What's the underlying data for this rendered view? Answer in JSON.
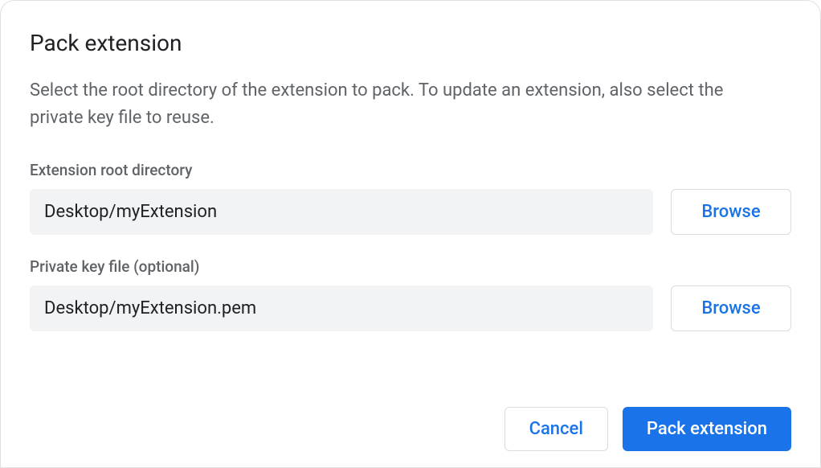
{
  "dialog": {
    "title": "Pack extension",
    "description": "Select the root directory of the extension to pack. To update an extension, also select the private key file to reuse.",
    "fields": {
      "root_directory": {
        "label": "Extension root directory",
        "value": "Desktop/myExtension",
        "browse_label": "Browse"
      },
      "private_key": {
        "label": "Private key file (optional)",
        "value": "Desktop/myExtension.pem",
        "browse_label": "Browse"
      }
    },
    "buttons": {
      "cancel": "Cancel",
      "confirm": "Pack extension"
    }
  }
}
